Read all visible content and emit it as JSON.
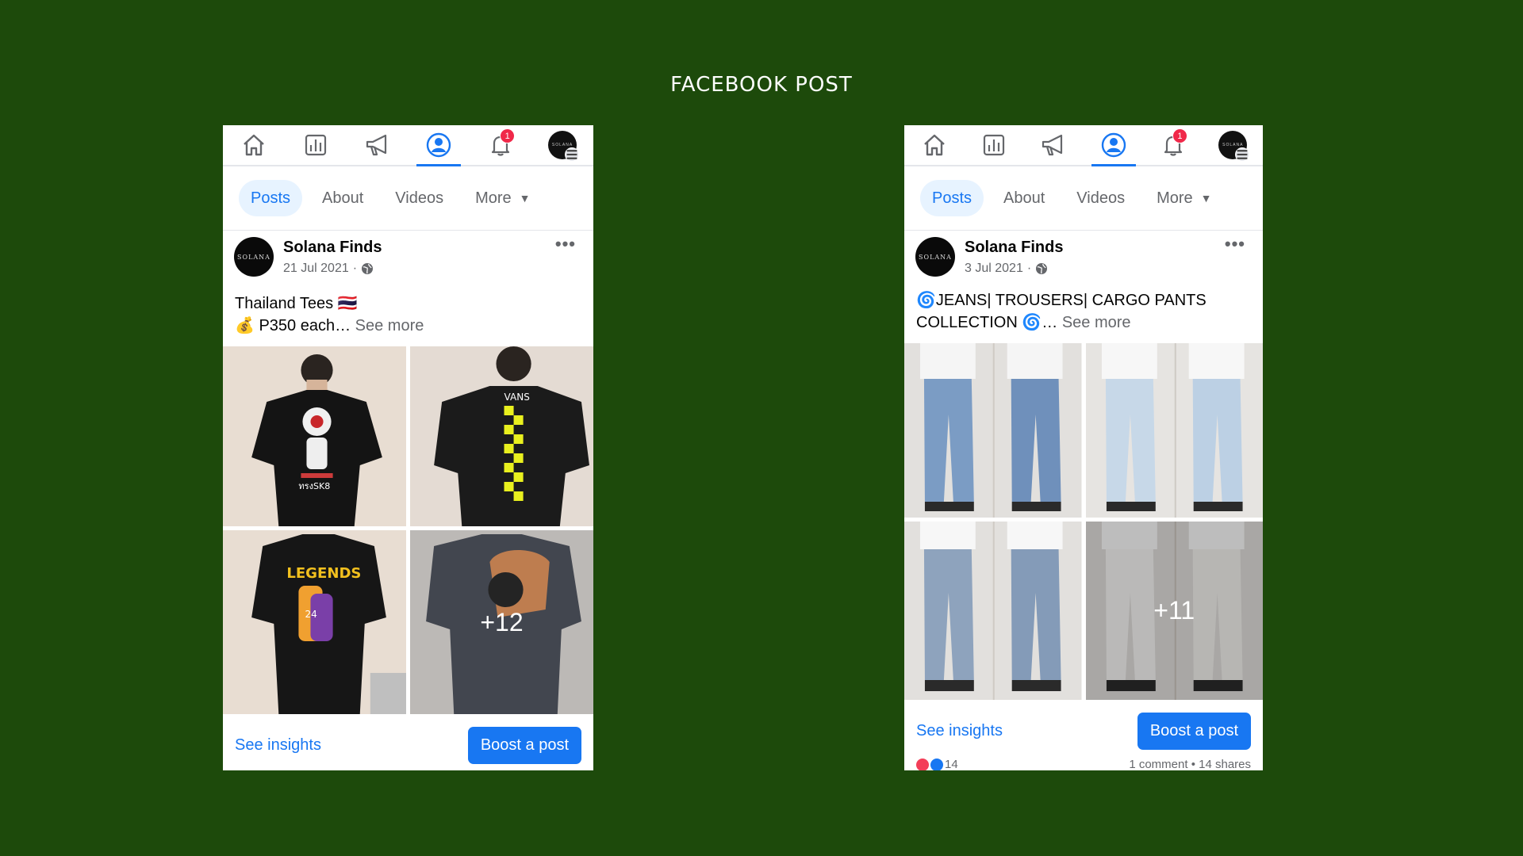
{
  "page": {
    "heading": "FACEBOOK POST"
  },
  "colors": {
    "background": "#1d4a0b",
    "accent": "#1877f2",
    "badge": "#f02849"
  },
  "nav": {
    "icons": [
      "home-icon",
      "insights-icon",
      "megaphone-icon",
      "profile-icon",
      "notification-bell-icon",
      "account-avatar"
    ],
    "notification_count": "1",
    "avatar_text": "SOLANA"
  },
  "tabs": [
    "Posts",
    "About",
    "Videos",
    "More"
  ],
  "posts": [
    {
      "author": "Solana Finds",
      "avatar_text": "SOLANA",
      "date": "21 Jul 2021",
      "separator": "·",
      "line1": "Thailand Tees 🇹🇭",
      "line2": "💰 P350 each…",
      "see_more": "See more",
      "extra_count": "+12",
      "images": [
        "black-tee-cartoon-skater",
        "black-tee-vans-checker",
        "black-tee-legends-24",
        "grey-tee-print"
      ],
      "insights_label": "See insights",
      "boost_label": "Boost a post"
    },
    {
      "author": "Solana Finds",
      "avatar_text": "SOLANA",
      "date": "3 Jul 2021",
      "separator": "·",
      "line1": "🌀JEANS| TROUSERS| CARGO PANTS",
      "line2": "COLLECTION 🌀…",
      "see_more": "See more",
      "extra_count": "+11",
      "images": [
        "blue-jeans",
        "light-jeans",
        "acid-wash-jeans",
        "white-trousers"
      ],
      "insights_label": "See insights",
      "boost_label": "Boost a post",
      "reaction_count": "14",
      "comments": "1 comment",
      "shares": "14 shares",
      "dot": "•"
    }
  ]
}
